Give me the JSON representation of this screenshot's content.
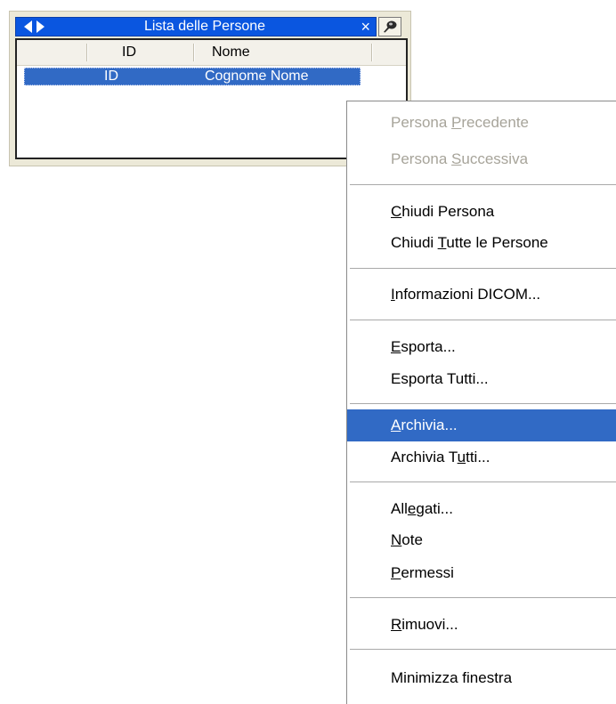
{
  "panel": {
    "title": "Lista delle Persone",
    "close_glyph": "×",
    "columns": [
      "ID",
      "Nome"
    ],
    "rows": [
      {
        "id": "ID",
        "name": "Cognome Nome",
        "selected": true
      }
    ]
  },
  "icons": {
    "prev": "left-triangle-arrow",
    "next": "right-triangle-arrow",
    "close": "x-close",
    "pin": "pin-tack"
  },
  "menu": {
    "items": [
      {
        "pre": "Persona ",
        "key": "P",
        "post": "recedente",
        "disabled": true
      },
      {
        "pre": "Persona ",
        "key": "S",
        "post": "uccessiva",
        "disabled": true
      },
      {
        "pre": "",
        "key": "C",
        "post": "hiudi Persona"
      },
      {
        "pre": "Chiudi ",
        "key": "T",
        "post": "utte le Persone"
      },
      {
        "pre": "",
        "key": "I",
        "post": "nformazioni DICOM..."
      },
      {
        "pre": "",
        "key": "E",
        "post": "sporta..."
      },
      {
        "pre": "Esporta Tutti...",
        "key": "",
        "post": ""
      },
      {
        "pre": "",
        "key": "A",
        "post": "rchivia...",
        "highlighted": true
      },
      {
        "pre": "Archivia T",
        "key": "u",
        "post": "tti..."
      },
      {
        "pre": "All",
        "key": "e",
        "post": "gati..."
      },
      {
        "pre": "",
        "key": "N",
        "post": "ote"
      },
      {
        "pre": "",
        "key": "P",
        "post": "ermessi"
      },
      {
        "pre": "",
        "key": "R",
        "post": "imuovi..."
      },
      {
        "pre": "Minimizza finestra",
        "key": "",
        "post": ""
      }
    ]
  },
  "colors": {
    "titlebar": "#0a56e0",
    "selection": "#316ac5",
    "disabled_text": "#a7a49a"
  }
}
